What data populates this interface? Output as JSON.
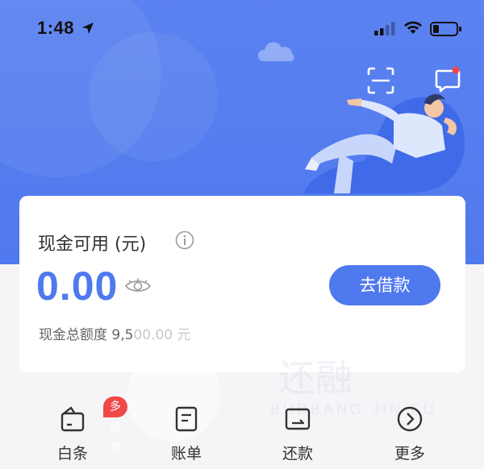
{
  "status_bar": {
    "time": "1:48",
    "battery_level": 0.25,
    "signal_bars": 2
  },
  "header": {
    "scan_icon": "scan-icon",
    "message_icon": "message-icon",
    "message_has_notification": true
  },
  "card": {
    "title": "现金可用 (元)",
    "amount": "0.00",
    "borrow_label": "去借款",
    "limit_prefix": "现金总额度 9,5",
    "limit_suffix": "00.00 元"
  },
  "nav": {
    "items": [
      {
        "label": "白条",
        "icon": "wallet-icon",
        "badge": "多场景"
      },
      {
        "label": "账单",
        "icon": "bill-icon"
      },
      {
        "label": "还款",
        "icon": "repay-icon"
      },
      {
        "label": "更多",
        "icon": "more-icon"
      }
    ]
  },
  "colors": {
    "primary": "#4f79ee",
    "badge": "#f04848",
    "background": "#f5f5f7"
  }
}
